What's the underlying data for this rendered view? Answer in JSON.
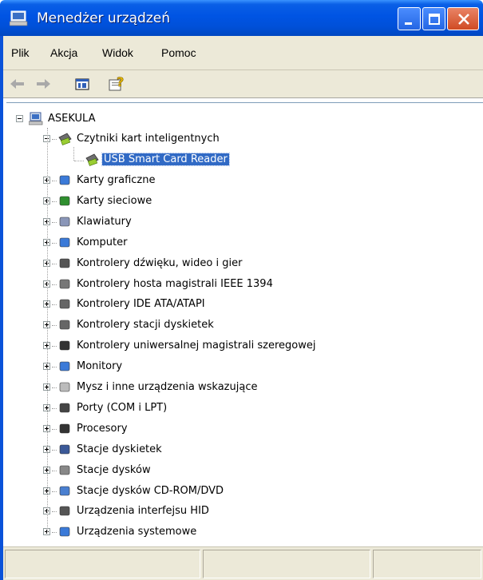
{
  "window": {
    "title": "Menedżer urządzeń"
  },
  "menu": [
    "Plik",
    "Akcja",
    "Widok",
    "Pomoc"
  ],
  "toolbar": {
    "back_icon": "arrow-left-icon",
    "forward_icon": "arrow-right-icon",
    "properties_icon": "properties-icon",
    "help_icon": "help-icon"
  },
  "tree": {
    "root": "ASEKULA",
    "expanded_category": "Czytniki kart inteligentnych",
    "selected_device": "USB Smart Card Reader",
    "categories": [
      "Karty graficzne",
      "Karty sieciowe",
      "Klawiatury",
      "Komputer",
      "Kontrolery dźwięku, wideo i gier",
      "Kontrolery hosta magistrali IEEE 1394",
      "Kontrolery IDE ATA/ATAPI",
      "Kontrolery stacji dyskietek",
      "Kontrolery uniwersalnej magistrali szeregowej",
      "Monitory",
      "Mysz i inne urządzenia wskazujące",
      "Porty (COM i LPT)",
      "Procesory",
      "Stacje dyskietek",
      "Stacje dysków",
      "Stacje dysków CD-ROM/DVD",
      "Urządzenia interfejsu HID",
      "Urządzenia systemowe"
    ]
  },
  "colors": {
    "titlebar": "#0054e3",
    "selection": "#316ac5",
    "chrome": "#ece9d8",
    "close_button": "#d04b23"
  }
}
